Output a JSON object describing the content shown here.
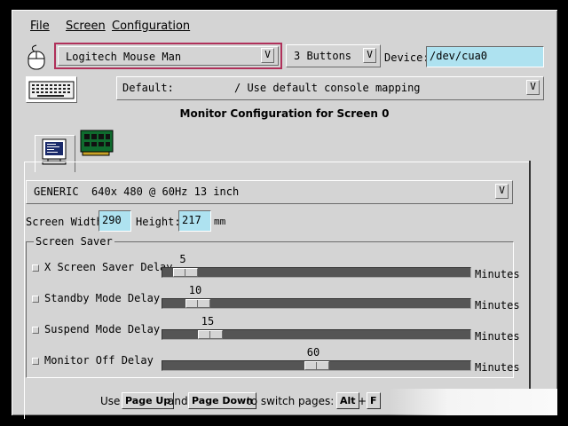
{
  "menu": {
    "file": "File",
    "screen": "Screen",
    "configuration": "Configuration"
  },
  "mouse": {
    "protocol": "Logitech Mouse Man",
    "buttons": "3 Buttons",
    "device_label": "Device:",
    "device": "/dev/cua0"
  },
  "keyboard": {
    "mapping_key": "Default:",
    "mapping_desc": "/ Use default console mapping"
  },
  "title": "Monitor Configuration for Screen 0",
  "monitor": {
    "preset": "GENERIC  640x 480 @ 60Hz 13 inch",
    "width_label": "Screen Width:",
    "width": "290",
    "height_label": "Height:",
    "height": "217",
    "unit": "mm"
  },
  "screen_saver": {
    "legend": "Screen Saver",
    "rows": [
      {
        "label": "X Screen Saver Delay",
        "value": "5",
        "unit": "Minutes"
      },
      {
        "label": "Standby Mode Delay",
        "value": "10",
        "unit": "Minutes"
      },
      {
        "label": "Suspend Mode Delay",
        "value": "15",
        "unit": "Minutes"
      },
      {
        "label": "Monitor Off Delay",
        "value": "60",
        "unit": "Minutes"
      }
    ]
  },
  "footer": {
    "use": "Use",
    "page_up": "Page Up",
    "and": "and",
    "page_down": "Page Down",
    "switch": "to switch pages:",
    "alt": "Alt",
    "plus": "+",
    "f": "F"
  },
  "colors": {
    "field_bg": "#aee2f0",
    "panel_bg": "#d4d4d4",
    "highlight_border": "#b0305a"
  },
  "icons": {
    "mouse": "mouse-icon",
    "keyboard": "keyboard-icon",
    "monitor": "monitor-icon",
    "card": "video-card-icon"
  }
}
